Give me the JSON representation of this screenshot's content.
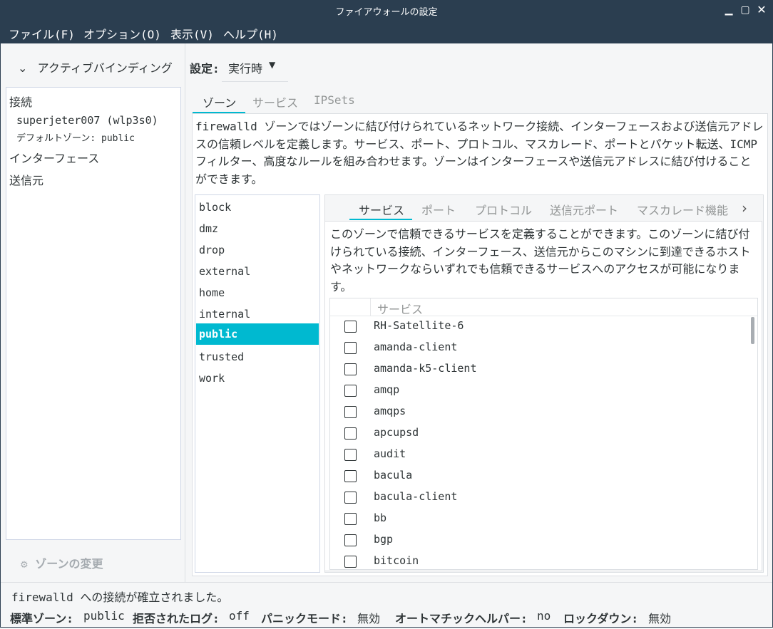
{
  "window": {
    "title": "ファイアウォールの設定"
  },
  "menu": [
    "ファイル(F)",
    "オプション(O)",
    "表示(V)",
    "ヘルプ(H)"
  ],
  "left": {
    "active_bindings": "アクティブバインディング",
    "connections": "接続",
    "connection_name": "superjeter007 (wlp3s0)",
    "default_zone": "デフォルトゾーン: public",
    "interfaces": "インターフェース",
    "sources": "送信元",
    "change_zone": "ゾーンの変更"
  },
  "config": {
    "label": "設定:",
    "value": "実行時"
  },
  "top_tabs": [
    "ゾーン",
    "サービス",
    "IPSets"
  ],
  "zone_description": [
    "firewalld ゾーンではゾーンに結び付けられているネットワーク接続、インターフェースおよび送信元アドレ",
    "スの信頼レベルを定義します。サービス、ポート、プロトコル、マスカレード、ポートとパケット転送、ICMP",
    "フィルター、高度なルールを組み合わせます。ゾーンはインターフェースや送信元アドレスに結び付けること",
    "ができます。"
  ],
  "zones": [
    "block",
    "dmz",
    "drop",
    "external",
    "home",
    "internal",
    "public",
    "trusted",
    "work"
  ],
  "selected_zone": "public",
  "sub_tabs": [
    "サービス",
    "ポート",
    "プロトコル",
    "送信元ポート",
    "マスカレード機能"
  ],
  "service_description": [
    "このゾーンで信頼できるサービスを定義することができます。このゾーンに結び付",
    "けられている接続、インターフェース、送信元からこのマシンに到達できるホスト",
    "やネットワークならいずれでも信頼できるサービスへのアクセスが可能になりま",
    "す。"
  ],
  "service_column": "サービス",
  "services": [
    "RH-Satellite-6",
    "amanda-client",
    "amanda-k5-client",
    "amqp",
    "amqps",
    "apcupsd",
    "audit",
    "bacula",
    "bacula-client",
    "bb",
    "bgp",
    "bitcoin"
  ],
  "status": {
    "message": "firewalld への接続が確立されました。",
    "default_zone_label": "標準ゾーン:",
    "default_zone": "public",
    "denied_log_label": "拒否されたログ:",
    "denied_log": "off",
    "panic_label": "パニックモード:",
    "panic": "無効",
    "helper_label": "オートマチックヘルパー:",
    "helper": "no",
    "lockdown_label": "ロックダウン:",
    "lockdown": "無効"
  },
  "colors": {
    "titlebar": "#2b3e50",
    "accent": "#00b9d0"
  }
}
